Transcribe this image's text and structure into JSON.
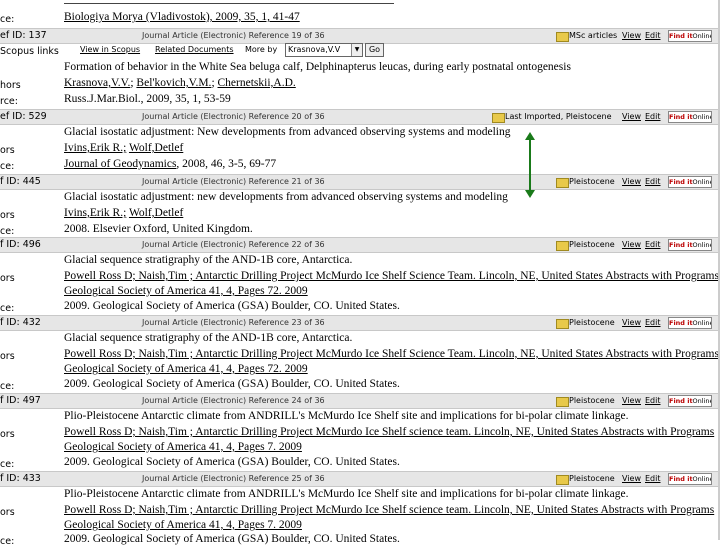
{
  "top_strip": {
    "label": "ce:",
    "source_text": "Biologiya Morya (Vladivostok), 2009, 35, 1, 41-47"
  },
  "rec1": {
    "id_label": "ef ID: 137",
    "band_text": "Journal Article (Electronic) Reference 19 of 36",
    "category": "MSc articles",
    "view": "View",
    "edit": "Edit",
    "findit": "Find it",
    "online": "Online",
    "links_label": "Scopus links",
    "view_in_scopus": "View in Scopus",
    "related_docs": "Related Documents",
    "more_by": "More by",
    "select_value": "Krasnova,V.V",
    "go": "Go",
    "title_label": "",
    "title": "Formation of behavior in the White Sea beluga calf, Delphinapterus leucas, during early postnatal ontogenesis",
    "authors_label": "hors",
    "authors": [
      "Krasnova,V.V.",
      "Bel'kovich,V.M.",
      "Chernetskii,A.D."
    ],
    "source_label": "rce:",
    "source": "Russ.J.Mar.Biol., 2009, 35, 1, 53-59"
  },
  "rec2": {
    "id_label": "ef ID: 529",
    "band_text": "Journal Article (Electronic) Reference 20 of 36",
    "category": "Last Imported, Pleistocene",
    "view": "View",
    "edit": "Edit",
    "findit": "Find it",
    "online": "Online",
    "title": "Glacial isostatic adjustment: New developments from advanced observing systems and modeling",
    "authors_label": "ors",
    "authors": [
      "Ivins,Erik R.;",
      "Wolf,Detlef"
    ],
    "source_label": "ce:",
    "source_journal": "Journal of Geodynamics",
    "source_rest": ", 2008, 46, 3-5, 69-77"
  },
  "rec3": {
    "id_label": "f ID: 445",
    "band_text": "Journal Article (Electronic) Reference 21 of 36",
    "category": "Pleistocene",
    "view": "View",
    "edit": "Edit",
    "findit": "Find it",
    "online": "Online",
    "title": "Glacial isostatic adjustment: new developments from advanced observing systems and modeling",
    "authors_label": "ors",
    "authors": [
      "Ivins,Erik R.;",
      "Wolf,Detlef"
    ],
    "source_label": "ce:",
    "source": "2008. Elsevier Oxford, United Kingdom."
  },
  "rec4": {
    "id_label": "f ID: 496",
    "band_text": "Journal Article (Electronic) Reference 22 of 36",
    "category": "Pleistocene",
    "view": "View",
    "edit": "Edit",
    "findit": "Find it",
    "online": "Online",
    "title": "Glacial sequence stratigraphy of the AND-1B core, Antarctica.",
    "authors_label": "ors",
    "authors_line1": "Powell Ross D; Naish,Tim ; Antarctic Drilling Project McMurdo Ice Shelf Science Team. Lincoln, NE, United States Abstracts with Programs",
    "authors_line2": "Geological Society of America 41, 4, Pages 72. 2009",
    "source_label": "ce:",
    "source": "2009. Geological Society of America (GSA) Boulder, CO. United States."
  },
  "rec5": {
    "id_label": "f ID: 432",
    "band_text": "Journal Article (Electronic) Reference 23 of 36",
    "category": "Pleistocene",
    "view": "View",
    "edit": "Edit",
    "findit": "Find it",
    "online": "Online",
    "title": "Glacial sequence stratigraphy of the AND-1B core, Antarctica.",
    "authors_label": "ors",
    "authors_line1": "Powell Ross D; Naish,Tim ; Antarctic Drilling Project McMurdo Ice Shelf Science Team. Lincoln, NE, United States Abstracts with Programs",
    "authors_line2": "Geological Society of America 41, 4, Pages 72. 2009",
    "source_label": "ce:",
    "source": "2009. Geological Society of America (GSA) Boulder, CO. United States."
  },
  "rec6": {
    "id_label": "f ID: 497",
    "band_text": "Journal Article (Electronic) Reference 24 of 36",
    "category": "Pleistocene",
    "view": "View",
    "edit": "Edit",
    "findit": "Find it",
    "online": "Online",
    "title": "Plio-Pleistocene Antarctic climate from ANDRILL's McMurdo Ice Shelf site and implications for bi-polar climate linkage.",
    "authors_label": "ors",
    "authors_line1": "Powell Ross D; Naish,Tim ; Antarctic Drilling Project McMurdo Ice Shelf science team. Lincoln, NE, United States Abstracts with Programs",
    "authors_line2": "Geological Society of America 41, 4, Pages 7. 2009",
    "source_label": "ce:",
    "source": "2009. Geological Society of America (GSA) Boulder, CO. United States."
  },
  "rec7": {
    "id_label": "f ID: 433",
    "band_text": "Journal Article (Electronic) Reference 25 of 36",
    "category": "Pleistocene",
    "view": "View",
    "edit": "Edit",
    "findit": "Find it",
    "online": "Online",
    "title": "Plio-Pleistocene Antarctic climate from ANDRILL's McMurdo Ice Shelf site and implications for bi-polar climate linkage.",
    "authors_label": "ors",
    "authors_line1": "Powell Ross D; Naish,Tim ; Antarctic Drilling Project McMurdo Ice Shelf science team. Lincoln, NE, United States Abstracts with Programs",
    "authors_line2": "Geological Society of America 41, 4, Pages 7. 2009",
    "source_label": "ce:",
    "source": "2009. Geological Society of America (GSA) Boulder, CO. United States."
  },
  "colors": {
    "band": "#e6e6e6",
    "folder": "#e8c94a",
    "arrow": "#1a7a1a",
    "findit_red": "#b00000"
  },
  "icons": {
    "folder": "folder-icon",
    "arrow": "double-arrow-icon",
    "dropdown": "chevron-down-icon"
  }
}
